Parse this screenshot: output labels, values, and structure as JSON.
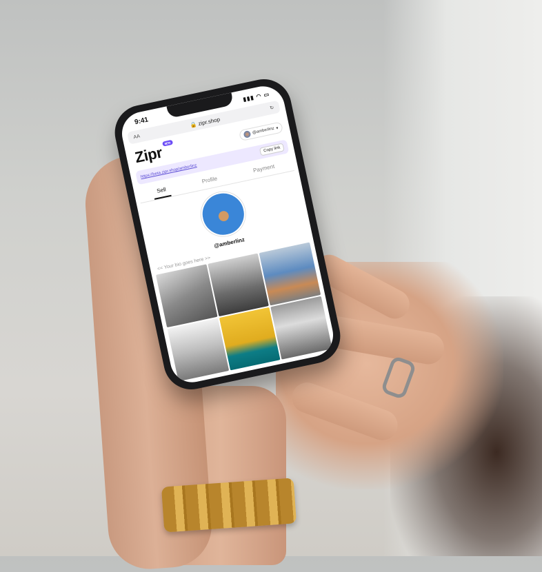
{
  "status_bar": {
    "time": "9:41",
    "icons": "signal-wifi-battery"
  },
  "browser": {
    "text_size": "AA",
    "url": "zipr.shop",
    "reload_icon": "reload-icon",
    "lock_icon": "lock-icon"
  },
  "header": {
    "logo": "Zipr",
    "beta_badge": "BETA",
    "username": "@amberlinz"
  },
  "share": {
    "link": "https://beta.zipr.shop/amberlinz",
    "copy_label": "Copy link"
  },
  "tabs": [
    {
      "label": "Sell"
    },
    {
      "label": "Profile"
    },
    {
      "label": "Payment"
    }
  ],
  "profile": {
    "handle": "@amberlinz",
    "bio": "<< Your bio goes here >>"
  },
  "colors": {
    "accent": "#6b4cf6",
    "link_bar": "#ede8ff"
  }
}
